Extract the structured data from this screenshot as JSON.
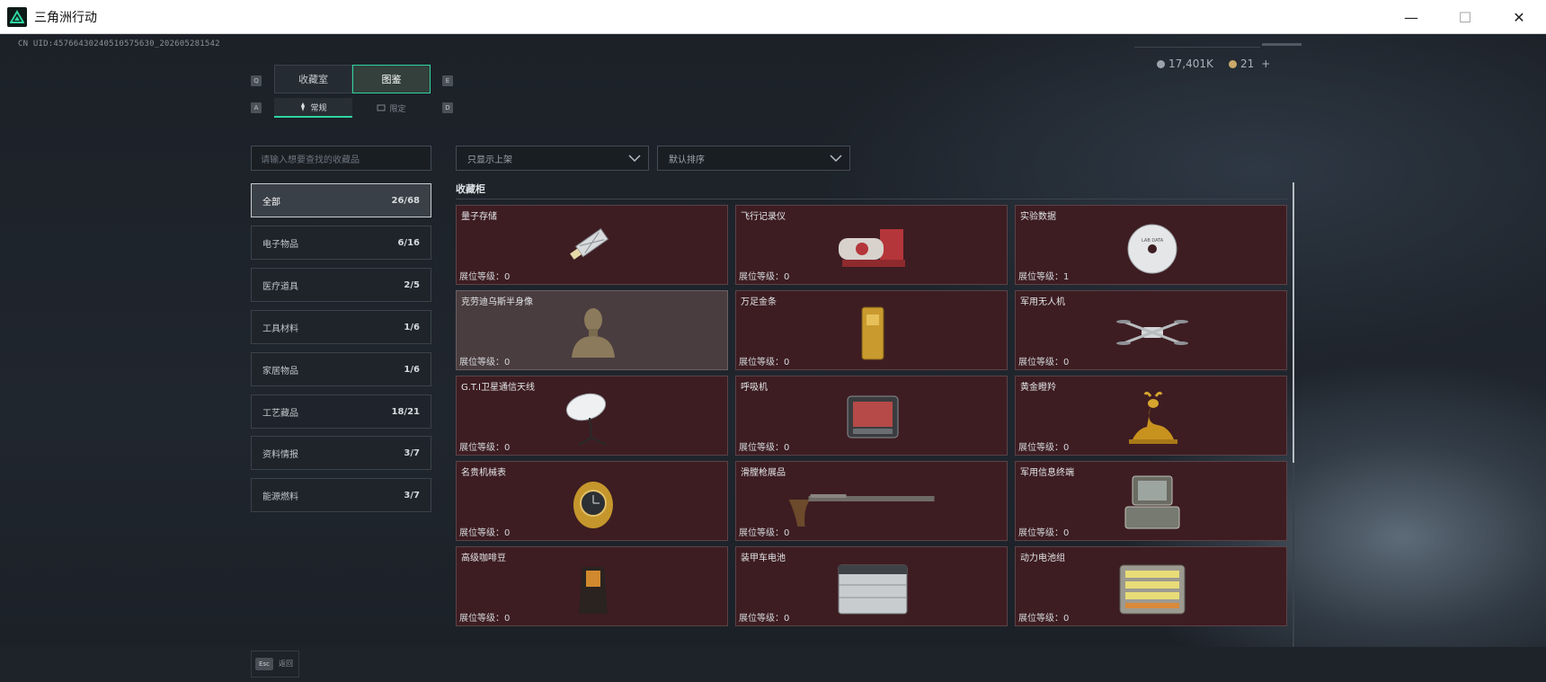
{
  "window": {
    "title": "三角洲行动",
    "minimize": "—",
    "maximize": "☐",
    "close": "✕"
  },
  "header": {
    "uid": "CN UID:4576643024051057563​0_202605281542",
    "currency_a": "17,401K",
    "currency_b": "21",
    "plus": "+"
  },
  "tabs": {
    "key_left": "Q",
    "key_right": "E",
    "items": [
      {
        "label": "收藏室"
      },
      {
        "label": "图鉴"
      }
    ],
    "sub_key_left": "A",
    "sub_key_right": "D",
    "subtabs": [
      {
        "label": "常规"
      },
      {
        "label": "限定"
      }
    ]
  },
  "search": {
    "placeholder": "请输入想要查找的收藏品"
  },
  "filters": [
    {
      "label": "只显示上架"
    },
    {
      "label": "默认排序"
    }
  ],
  "categories": [
    {
      "label": "全部",
      "count": "26/68"
    },
    {
      "label": "电子物品",
      "count": "6/16"
    },
    {
      "label": "医疗道具",
      "count": "2/5"
    },
    {
      "label": "工具材料",
      "count": "1/6"
    },
    {
      "label": "家居物品",
      "count": "1/6"
    },
    {
      "label": "工艺藏品",
      "count": "18/21"
    },
    {
      "label": "资料情报",
      "count": "3/7"
    },
    {
      "label": "能源燃料",
      "count": "3/7"
    }
  ],
  "section": {
    "title": "收藏柜"
  },
  "items": [
    {
      "name": "量子存储",
      "level": "展位等级：0",
      "icon": "usb-drive-icon"
    },
    {
      "name": "飞行记录仪",
      "level": "展位等级：0",
      "icon": "flight-recorder-icon"
    },
    {
      "name": "实验数据",
      "level": "展位等级：1",
      "icon": "disc-icon"
    },
    {
      "name": "克劳迪乌斯半身像",
      "level": "展位等级：0",
      "icon": "bust-statue-icon"
    },
    {
      "name": "万足金条",
      "level": "展位等级：0",
      "icon": "gold-bar-icon"
    },
    {
      "name": "军用无人机",
      "level": "展位等级：0",
      "icon": "drone-icon"
    },
    {
      "name": "G.T.I卫星通信天线",
      "level": "展位等级：0",
      "icon": "satellite-antenna-icon"
    },
    {
      "name": "呼吸机",
      "level": "展位等级：0",
      "icon": "ventilator-icon"
    },
    {
      "name": "黄金瞪羚",
      "level": "展位等级：0",
      "icon": "golden-gazelle-icon"
    },
    {
      "name": "名贵机械表",
      "level": "展位等级：0",
      "icon": "watch-icon"
    },
    {
      "name": "滑膛枪展品",
      "level": "展位等级：0",
      "icon": "musket-icon"
    },
    {
      "name": "军用信息终端",
      "level": "展位等级：0",
      "icon": "terminal-icon"
    },
    {
      "name": "高级咖啡豆",
      "level": "展位等级：0",
      "icon": "coffee-bag-icon"
    },
    {
      "name": "装甲车电池",
      "level": "展位等级：0",
      "icon": "battery-icon"
    },
    {
      "name": "动力电池组",
      "level": "展位等级：0",
      "icon": "battery-pack-icon"
    }
  ],
  "footer": {
    "esc_key": "Esc",
    "esc_label": "返回"
  },
  "colors": {
    "accent": "#2fd5a0",
    "card_bg": "#3d1d22",
    "card_hi": "#4a3d3f"
  }
}
